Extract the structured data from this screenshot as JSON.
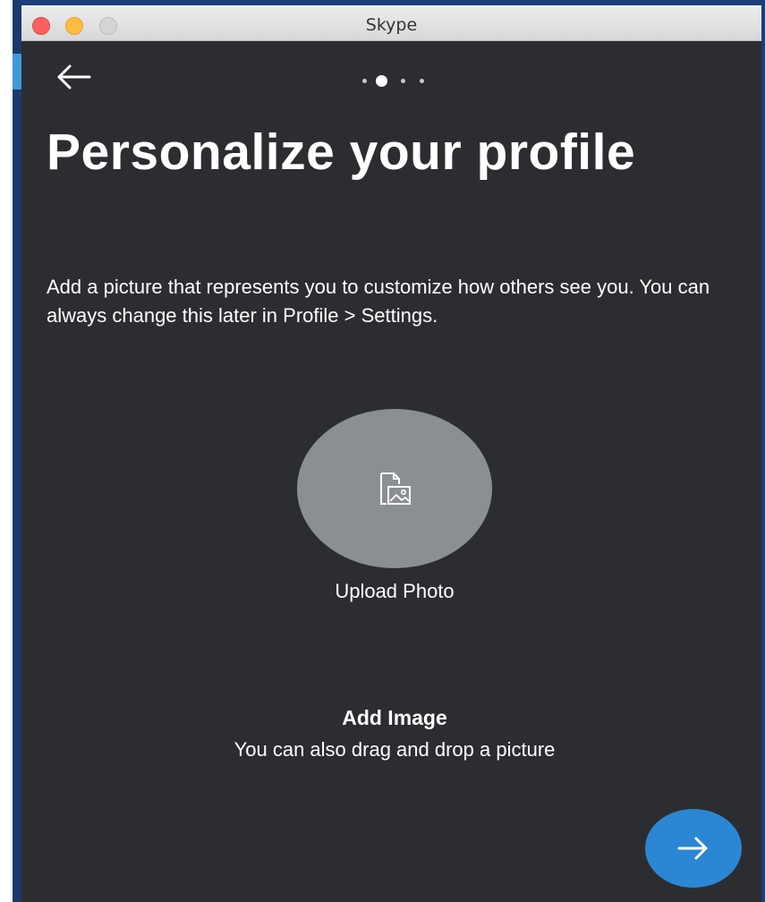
{
  "window": {
    "title": "Skype"
  },
  "navigation": {
    "back_icon": "arrow-left-icon",
    "pager": {
      "total_pages": 4,
      "current_page": 2
    }
  },
  "content": {
    "heading": "Personalize your profile",
    "description": "Add a picture that represents you to customize how others see you. You can always change this later in Profile > Settings.",
    "upload": {
      "icon": "image-file-icon",
      "label": "Upload Photo"
    },
    "drop_zone": {
      "title": "Add Image",
      "subtitle": "You can also drag and drop a picture"
    }
  },
  "actions": {
    "next_icon": "arrow-right-icon"
  },
  "colors": {
    "background": "#2c2d31",
    "avatar_placeholder": "#8b8e93",
    "accent": "#2b87d3",
    "text": "#ffffff"
  }
}
